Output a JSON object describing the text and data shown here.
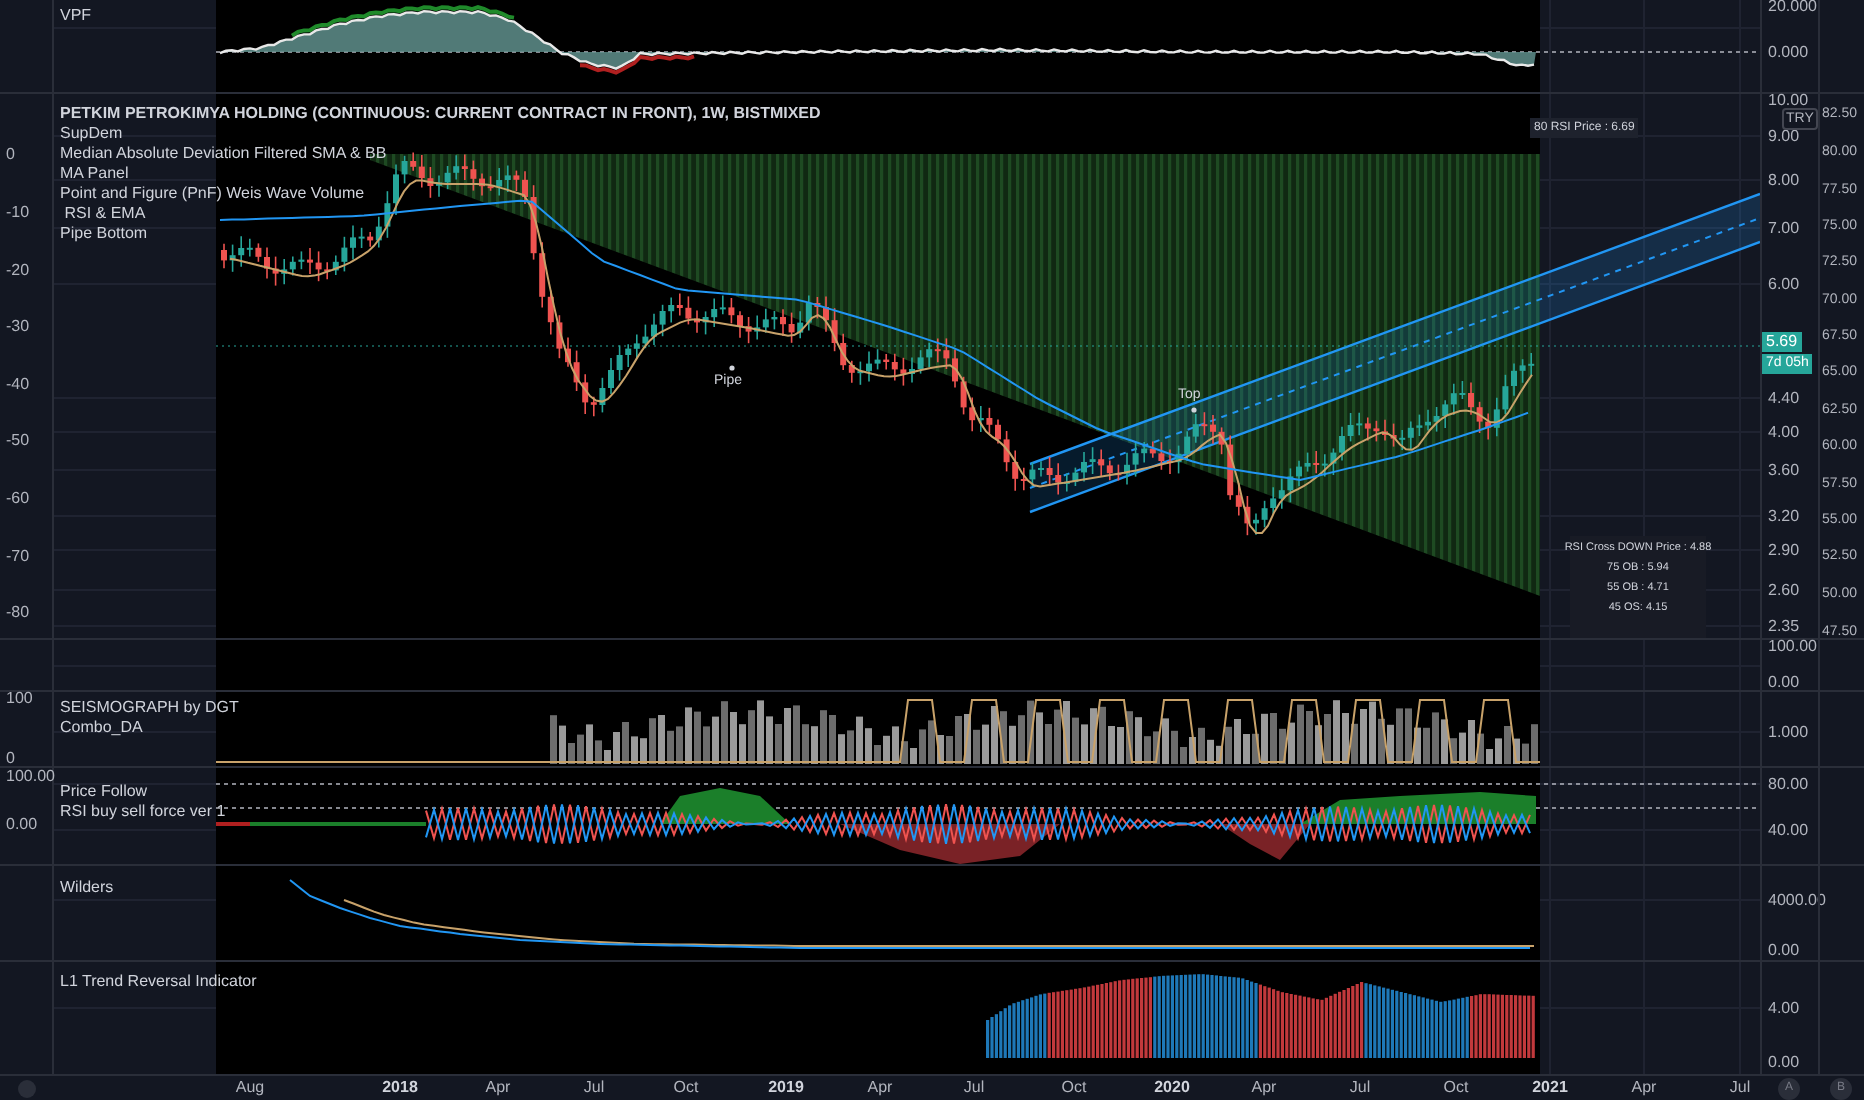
{
  "vpf_pane": {
    "legend": [
      "VPF"
    ],
    "right_axis": [
      "20.000",
      "0.000"
    ]
  },
  "main_pane": {
    "title": "PETKIM PETROKIMYA HOLDING (CONTINUOUS: CURRENT CONTRACT IN FRONT), 1W, BISTMIXED",
    "legend": [
      "SupDem",
      "Median Absolute Deviation Filtered SMA & BB",
      "MA Panel",
      "Point and Figure (PnF) Weis Wave Volume",
      " RSI & EMA",
      "Pipe Bottom"
    ],
    "left_axis": [
      "0",
      "-10",
      "-20",
      "-30",
      "-40",
      "-50",
      "-60",
      "-70",
      "-80"
    ],
    "right_axis": [
      "10.00",
      "9.00",
      "8.00",
      "7.00",
      "6.00",
      "4.40",
      "4.00",
      "3.60",
      "3.20",
      "2.90",
      "2.60",
      "2.35"
    ],
    "right_axis_2": [
      "82.50",
      "80.00",
      "77.50",
      "75.00",
      "72.50",
      "70.00",
      "67.50",
      "65.00",
      "62.50",
      "60.00",
      "57.50",
      "55.00",
      "52.50",
      "50.00",
      "47.50"
    ],
    "currency": "TRY",
    "last_price": "5.69",
    "countdown": "7d 05h",
    "rsi_price_label": "80 RSI Price : 6.69",
    "rsi_panel": [
      "RSI Cross DOWN Price : 4.88",
      "75 OB : 5.94",
      "55 OB : 4.71",
      "45 OS: 4.15"
    ],
    "markers": [
      "Pipe",
      "Top"
    ]
  },
  "empty_pane": {
    "right_axis": [
      "100.00",
      "0.00"
    ]
  },
  "seismograph_pane": {
    "legend": [
      "SEISMOGRAPH by DGT",
      "Combo_DA"
    ],
    "left_axis": [
      "100",
      "0"
    ],
    "right_axis": [
      "1.000"
    ]
  },
  "price_follow_pane": {
    "legend": [
      "Price Follow",
      "RSI buy sell force ver 1"
    ],
    "left_axis": [
      "100.00",
      "0.00"
    ],
    "right_axis": [
      "80.00",
      "40.00"
    ]
  },
  "wilders_pane": {
    "legend": [
      "Wilders"
    ],
    "right_axis": [
      "4000.00",
      "0.00"
    ]
  },
  "trend_pane": {
    "legend": [
      "L1 Trend Reversal Indicator"
    ],
    "right_axis": [
      "4.00",
      "0.00"
    ]
  },
  "time_axis": [
    "Aug",
    "2018",
    "Apr",
    "Jul",
    "Oct",
    "2019",
    "Apr",
    "Jul",
    "Oct",
    "2020",
    "Apr",
    "Jul",
    "Oct",
    "2021",
    "Apr",
    "Jul"
  ],
  "scale_buttons": [
    "A",
    "B"
  ]
}
